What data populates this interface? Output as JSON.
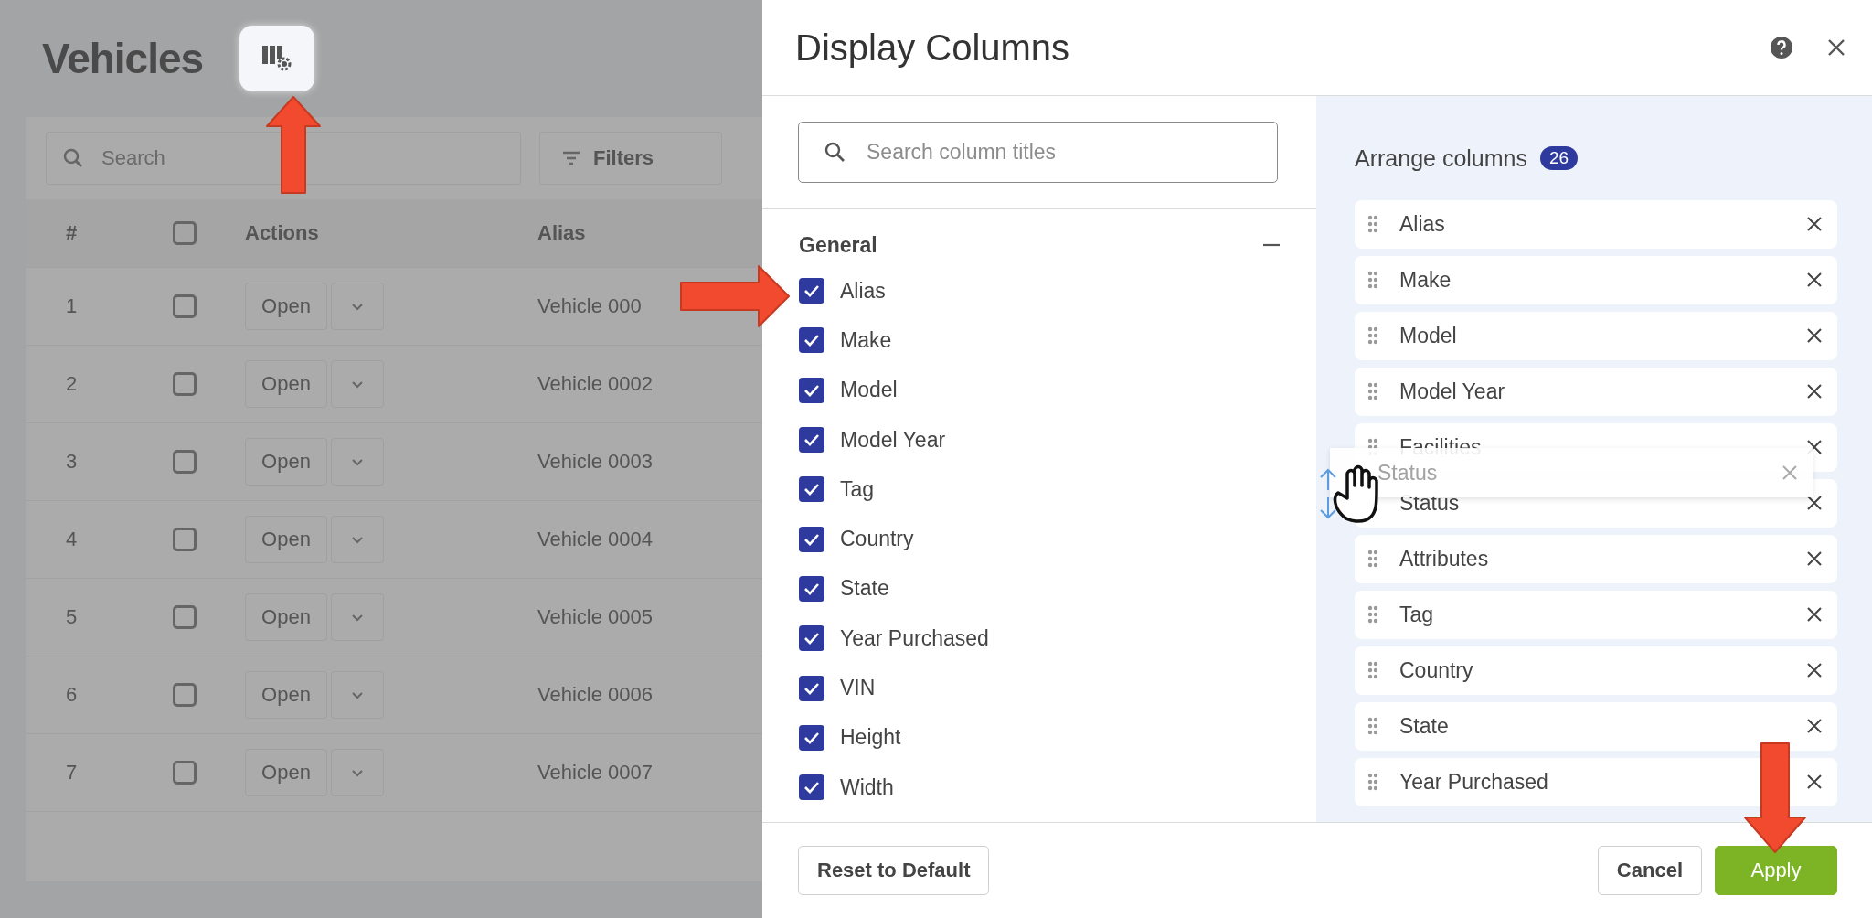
{
  "background_page": {
    "title": "Vehicles",
    "search": {
      "placeholder": "Search"
    },
    "filters_button": "Filters",
    "table": {
      "columns": [
        "#",
        "Actions",
        "Alias"
      ],
      "select_all_checked": false,
      "rows": [
        {
          "number": "1",
          "checked": false,
          "action": "Open",
          "alias": "Vehicle 000"
        },
        {
          "number": "2",
          "checked": false,
          "action": "Open",
          "alias": "Vehicle 0002"
        },
        {
          "number": "3",
          "checked": false,
          "action": "Open",
          "alias": "Vehicle 0003"
        },
        {
          "number": "4",
          "checked": false,
          "action": "Open",
          "alias": "Vehicle 0004"
        },
        {
          "number": "5",
          "checked": false,
          "action": "Open",
          "alias": "Vehicle 0005"
        },
        {
          "number": "6",
          "checked": false,
          "action": "Open",
          "alias": "Vehicle 0006"
        },
        {
          "number": "7",
          "checked": false,
          "action": "Open",
          "alias": "Vehicle 0007"
        }
      ]
    }
  },
  "dialog": {
    "title": "Display Columns",
    "search": {
      "placeholder": "Search column titles"
    },
    "groups": [
      {
        "name": "General",
        "expanded": true,
        "items": [
          {
            "label": "Alias",
            "checked": true
          },
          {
            "label": "Make",
            "checked": true
          },
          {
            "label": "Model",
            "checked": true
          },
          {
            "label": "Model Year",
            "checked": true
          },
          {
            "label": "Tag",
            "checked": true
          },
          {
            "label": "Country",
            "checked": true
          },
          {
            "label": "State",
            "checked": true
          },
          {
            "label": "Year Purchased",
            "checked": true
          },
          {
            "label": "VIN",
            "checked": true
          },
          {
            "label": "Height",
            "checked": true
          },
          {
            "label": "Width",
            "checked": true
          }
        ]
      }
    ],
    "arrange": {
      "title": "Arrange columns",
      "count": "26",
      "items": [
        {
          "label": "Alias"
        },
        {
          "label": "Make"
        },
        {
          "label": "Model"
        },
        {
          "label": "Model Year"
        },
        {
          "label": "Facilities"
        },
        {
          "label": "Status"
        },
        {
          "label": "Attributes"
        },
        {
          "label": "Tag"
        },
        {
          "label": "Country"
        },
        {
          "label": "State"
        },
        {
          "label": "Year Purchased"
        }
      ]
    },
    "drag_ghost": {
      "label": "Status"
    },
    "buttons": [
      {
        "label": "Reset to Default",
        "kind": "reset"
      },
      {
        "label": "Cancel",
        "kind": "secondary"
      },
      {
        "label": "Apply",
        "kind": "primary"
      }
    ]
  }
}
